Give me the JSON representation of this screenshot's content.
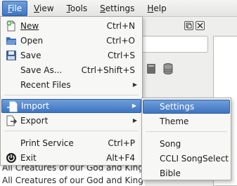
{
  "menubar": {
    "items": [
      {
        "label": "File",
        "mnemonic": "F",
        "rest": "ile",
        "active": true
      },
      {
        "label": "View",
        "mnemonic": "V",
        "rest": "iew"
      },
      {
        "label": "Tools",
        "mnemonic": "T",
        "rest": "ools"
      },
      {
        "label": "Settings",
        "mnemonic": "S",
        "rest": "ettings"
      },
      {
        "label": "Help",
        "mnemonic": "H",
        "rest": "elp"
      }
    ]
  },
  "file_menu": {
    "items": [
      {
        "label": "New",
        "shortcut": "Ctrl+N",
        "icon": "new-document-icon"
      },
      {
        "label": "Open",
        "shortcut": "Ctrl+O",
        "icon": "open-folder-icon"
      },
      {
        "label": "Save",
        "shortcut": "Ctrl+S",
        "icon": "save-icon"
      },
      {
        "label": "Save As...",
        "shortcut": "Ctrl+Shift+S"
      },
      {
        "label": "Recent Files",
        "submenu": true
      },
      {
        "label": "Import",
        "submenu": true,
        "icon": "import-icon",
        "highlighted": true
      },
      {
        "label": "Export",
        "submenu": true,
        "icon": "export-icon"
      },
      {
        "label": "Print Service",
        "shortcut": "Ctrl+P"
      },
      {
        "label": "Exit",
        "shortcut": "Alt+F4",
        "icon": "exit-icon"
      }
    ]
  },
  "import_submenu": {
    "items": [
      {
        "label": "Settings",
        "highlighted": true
      },
      {
        "label": "Theme"
      },
      {
        "label": "Song"
      },
      {
        "label": "CCLI SongSelect"
      },
      {
        "label": "Bible"
      }
    ]
  },
  "background": {
    "songs": [
      "All Creatures of our God and King (St.",
      "All Creatures of our God and King (St."
    ]
  },
  "colors": {
    "highlight": "#4a7fcc",
    "menu_bg": "#f7f7f6"
  }
}
